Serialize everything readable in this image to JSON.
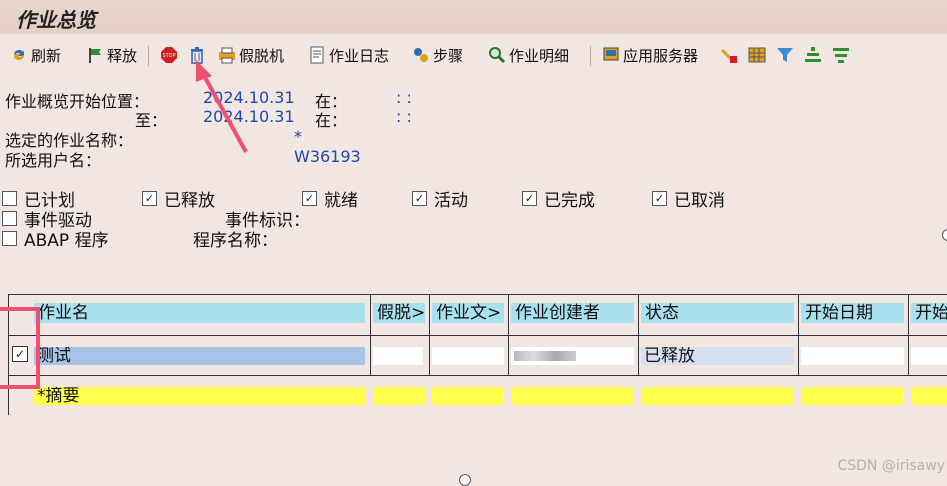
{
  "title": "作业总览",
  "toolbar": {
    "refresh": "刷新",
    "release": "释放",
    "stop_icon_text": "STOP",
    "offline": "假脱机",
    "job_log": "作业日志",
    "steps": "步骤",
    "job_detail": "作业明细",
    "app_server": "应用服务器"
  },
  "filters": {
    "start_label": "作业概览开始位置：",
    "start_date": "2024.10.31",
    "start_at": "在：",
    "start_time": ":  :",
    "to_label": "至：",
    "to_date": "2024.10.31",
    "to_at": "在：",
    "to_time": ":  :",
    "job_name_label": "选定的作业名称：",
    "job_name_value": "*",
    "user_label": "所选用户名：",
    "user_value": "W36193"
  },
  "status_checks": [
    {
      "label": "已计划",
      "checked": false
    },
    {
      "label": "已释放",
      "checked": true
    },
    {
      "label": "就绪",
      "checked": true
    },
    {
      "label": "活动",
      "checked": true
    },
    {
      "label": "已完成",
      "checked": true
    },
    {
      "label": "已取消",
      "checked": true
    }
  ],
  "event": {
    "label": "事件驱动",
    "id_label": "事件标识：",
    "checked": false
  },
  "abap": {
    "label": "ABAP 程序",
    "prog_label": "程序名称：",
    "checked": false
  },
  "grid": {
    "headers": [
      "作业名",
      "假脱>",
      "作业文>",
      "作业创建者",
      "状态",
      "开始日期",
      "开始"
    ],
    "row1": {
      "name": "测试",
      "status": "已释放",
      "checked": true
    },
    "summary": "*摘要"
  },
  "watermark": "CSDN @irisawy"
}
